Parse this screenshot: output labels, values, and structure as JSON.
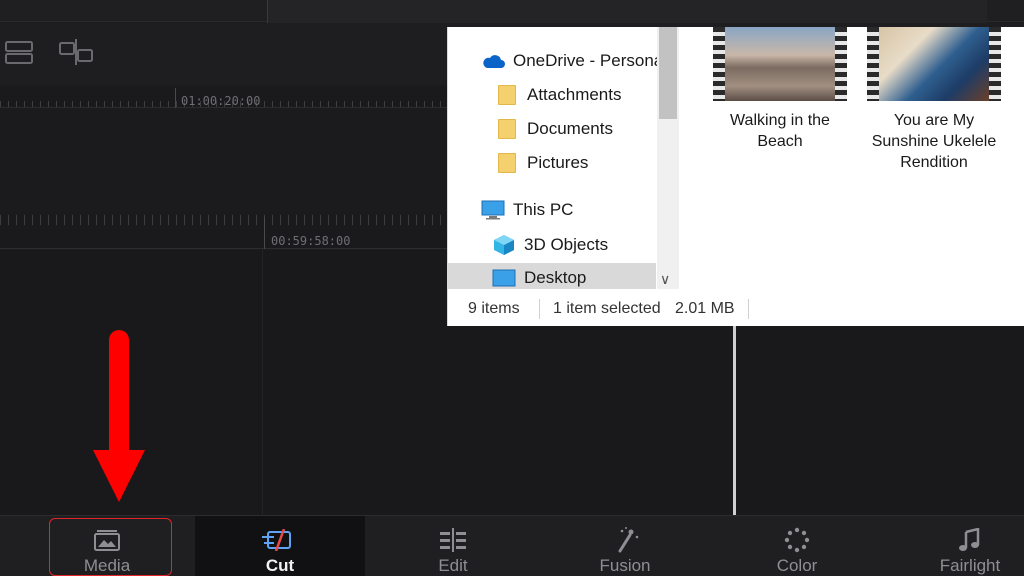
{
  "timeline": {
    "timecode_upper": "01:00:20:00",
    "timecode_lower": "00:59:58:00"
  },
  "page_nav": {
    "tabs": [
      {
        "label": "Media",
        "icon": "media-icon"
      },
      {
        "label": "Cut",
        "icon": "cut-icon",
        "active": true
      },
      {
        "label": "Edit",
        "icon": "edit-icon"
      },
      {
        "label": "Fusion",
        "icon": "fusion-icon"
      },
      {
        "label": "Color",
        "icon": "color-icon"
      },
      {
        "label": "Fairlight",
        "icon": "fairlight-icon"
      }
    ],
    "highlight_color": "#e0262b"
  },
  "annotation": {
    "arrow_color": "#ff0000",
    "arrow_target": "Media"
  },
  "explorer": {
    "nav_items": [
      {
        "label": "OneDrive - Persona",
        "icon": "onedrive-icon"
      },
      {
        "label": "Attachments",
        "icon": "folder-icon"
      },
      {
        "label": "Documents",
        "icon": "folder-icon"
      },
      {
        "label": "Pictures",
        "icon": "folder-icon"
      },
      {
        "label": "This PC",
        "icon": "computer-icon"
      },
      {
        "label": "3D Objects",
        "icon": "3d-objects-icon"
      },
      {
        "label": "Desktop",
        "icon": "desktop-icon",
        "selected": true
      }
    ],
    "files": [
      {
        "name": "Walking in the Beach",
        "line1": "Walking in the",
        "line2": "Beach",
        "line3": ""
      },
      {
        "name": "You are My Sunshine Ukelele Rendition",
        "line1": "You are My",
        "line2": "Sunshine Ukelele",
        "line3": "Rendition"
      }
    ],
    "status": {
      "items": "9 items",
      "selected": "1 item selected",
      "size": "2.01 MB"
    }
  }
}
